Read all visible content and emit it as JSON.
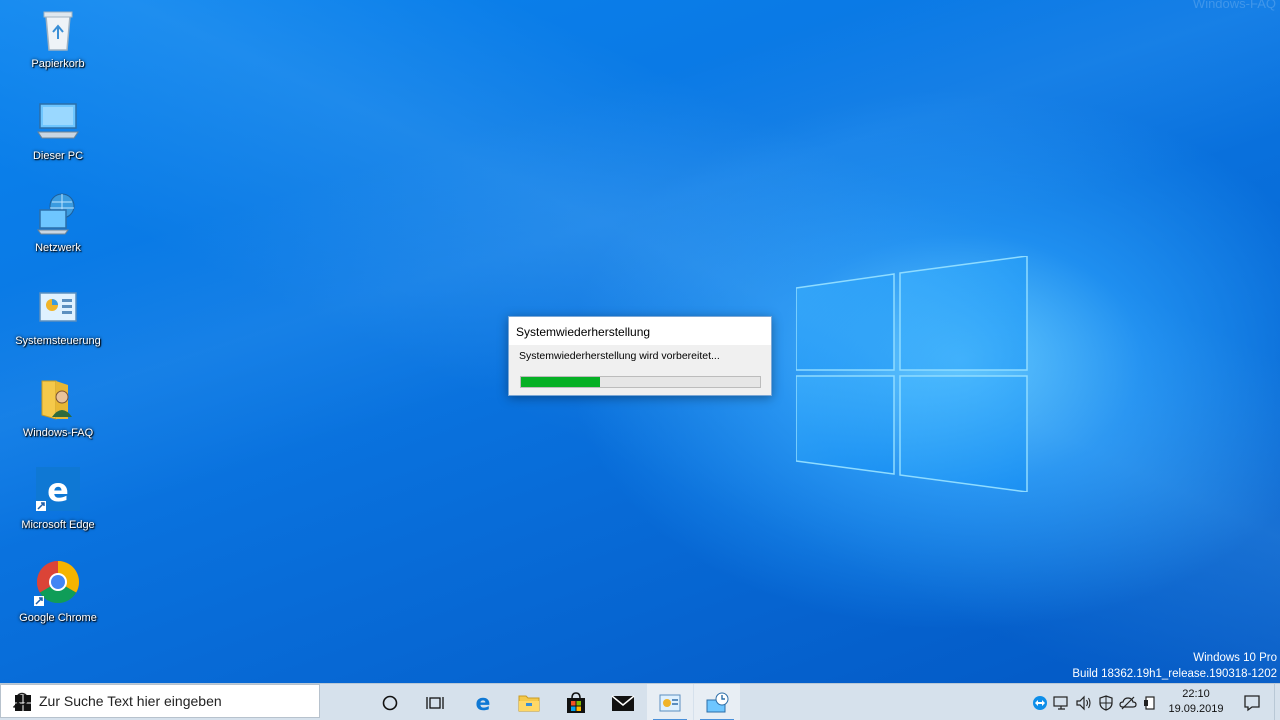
{
  "watermark": "Windows-FAQ",
  "desktop_icons": [
    {
      "label": "Papierkorb",
      "icon": "recycle-bin-icon"
    },
    {
      "label": "Dieser PC",
      "icon": "computer-icon"
    },
    {
      "label": "Netzwerk",
      "icon": "network-icon"
    },
    {
      "label": "Systemsteuerung",
      "icon": "control-panel-icon"
    },
    {
      "label": "Windows-FAQ",
      "icon": "user-folder-icon"
    },
    {
      "label": "Microsoft Edge",
      "icon": "edge-icon"
    },
    {
      "label": "Google Chrome",
      "icon": "chrome-icon"
    }
  ],
  "dialog": {
    "title": "Systemwiederherstellung",
    "message": "Systemwiederherstellung wird vorbereitet...",
    "progress": 0.33
  },
  "build_info": {
    "edition": "Windows 10 Pro",
    "build": "Build 18362.19h1_release.190318-1202"
  },
  "taskbar": {
    "search_placeholder": "Zur Suche Text hier eingeben",
    "pinned": [
      "cortana-icon",
      "task-view-icon",
      "edge-icon",
      "file-explorer-icon",
      "store-icon",
      "mail-icon",
      "control-panel-icon",
      "system-restore-icon"
    ],
    "tray": [
      "teamviewer-icon",
      "network-icon",
      "volume-icon",
      "security-icon",
      "onedrive-icon",
      "device-icon"
    ],
    "time": "22:10",
    "date": "19.09.2019"
  },
  "colors": {
    "desktop_accent": "#0a74e0",
    "progress_fill": "#06b025",
    "taskbar": "#d6e1ec"
  }
}
